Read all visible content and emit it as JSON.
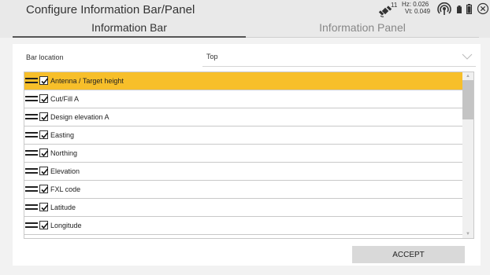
{
  "header": {
    "title": "Configure Information Bar/Panel",
    "status": {
      "satellite_count": "11",
      "hz": "Hz: 0.026",
      "vt": "Vt: 0.049"
    }
  },
  "tabs": [
    {
      "label": "Information Bar",
      "active": true
    },
    {
      "label": "Information Panel",
      "active": false
    }
  ],
  "bar_location": {
    "label": "Bar location",
    "value": "Top"
  },
  "items": [
    {
      "label": "Antenna / Target height",
      "checked": true,
      "selected": true
    },
    {
      "label": "Cut/Fill A",
      "checked": true,
      "selected": false
    },
    {
      "label": "Design elevation A",
      "checked": true,
      "selected": false
    },
    {
      "label": "Easting",
      "checked": true,
      "selected": false
    },
    {
      "label": "Northing",
      "checked": true,
      "selected": false
    },
    {
      "label": "Elevation",
      "checked": true,
      "selected": false
    },
    {
      "label": "FXL code",
      "checked": true,
      "selected": false
    },
    {
      "label": "Latitude",
      "checked": true,
      "selected": false
    },
    {
      "label": "Longitude",
      "checked": true,
      "selected": false
    }
  ],
  "accept_label": "ACCEPT",
  "colors": {
    "selected_row": "#f7bf2a",
    "header_bg": "#e9e9e9"
  }
}
